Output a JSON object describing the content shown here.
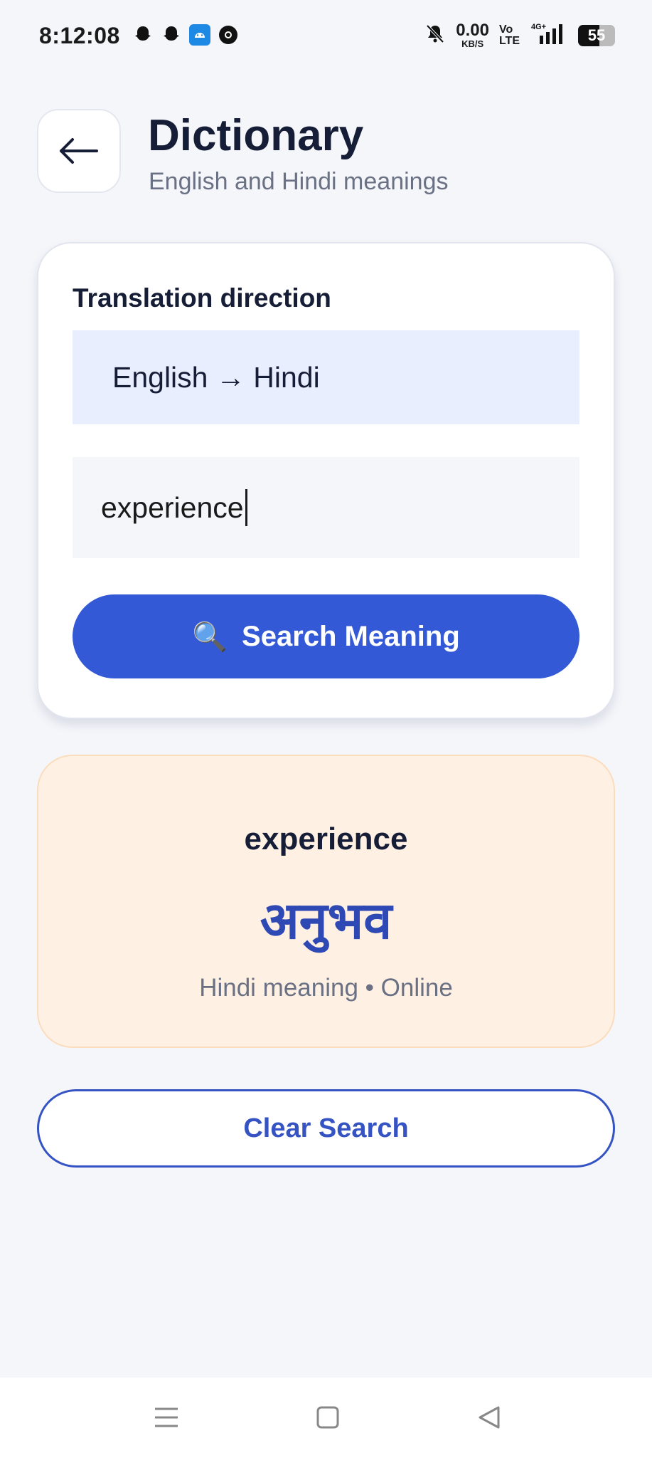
{
  "status_bar": {
    "time": "8:12:08",
    "net_speed_value": "0.00",
    "net_speed_unit": "KB/S",
    "volte_top": "Vo",
    "volte_bottom": "LTE",
    "network": "4G+",
    "battery": "55"
  },
  "header": {
    "title": "Dictionary",
    "subtitle": "English and Hindi meanings"
  },
  "search": {
    "direction_label": "Translation direction",
    "direction_value": "English → Hindi",
    "input_value": "experience",
    "button_label": "Search Meaning",
    "button_icon": "🔍"
  },
  "result": {
    "word": "experience",
    "meaning": "अनुभव",
    "meta": "Hindi meaning • Online"
  },
  "actions": {
    "clear_label": "Clear Search"
  },
  "colors": {
    "primary": "#3359d6",
    "result_bg": "#fff0e4",
    "meaning": "#2e49b4"
  }
}
